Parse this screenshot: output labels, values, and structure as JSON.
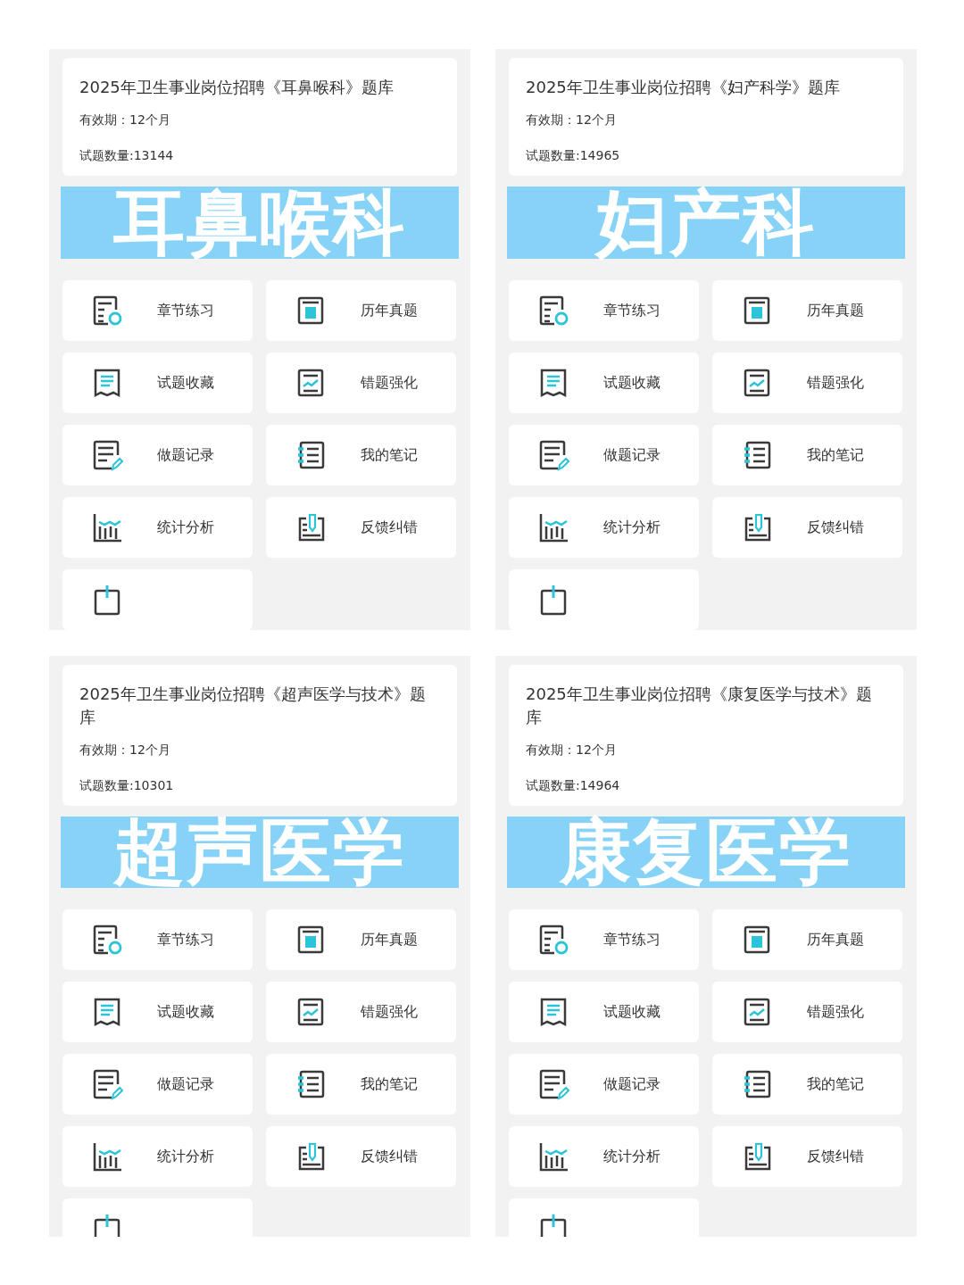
{
  "panels": [
    {
      "title": "2025年卫生事业岗位招聘《耳鼻喉科》题库",
      "validity": "有效期：12个月",
      "count": "试题数量:13144",
      "banner": "耳鼻喉科",
      "menu": [
        "章节练习",
        "历年真题",
        "试题收藏",
        "错题强化",
        "做题记录",
        "我的笔记",
        "统计分析",
        "反馈纠错"
      ]
    },
    {
      "title": "2025年卫生事业岗位招聘《妇产科学》题库",
      "validity": "有效期：12个月",
      "count": "试题数量:14965",
      "banner": "妇产科",
      "menu": [
        "章节练习",
        "历年真题",
        "试题收藏",
        "错题强化",
        "做题记录",
        "我的笔记",
        "统计分析",
        "反馈纠错"
      ]
    },
    {
      "title": "2025年卫生事业岗位招聘《超声医学与技术》题库",
      "validity": "有效期：12个月",
      "count": "试题数量:10301",
      "banner": "超声医学",
      "menu": [
        "章节练习",
        "历年真题",
        "试题收藏",
        "错题强化",
        "做题记录",
        "我的笔记",
        "统计分析",
        "反馈纠错"
      ]
    },
    {
      "title": "2025年卫生事业岗位招聘《康复医学与技术》题库",
      "validity": "有效期：12个月",
      "count": "试题数量:14964",
      "banner": "康复医学",
      "menu": [
        "章节练习",
        "历年真题",
        "试题收藏",
        "错题强化",
        "做题记录",
        "我的笔记",
        "统计分析",
        "反馈纠错"
      ]
    }
  ]
}
